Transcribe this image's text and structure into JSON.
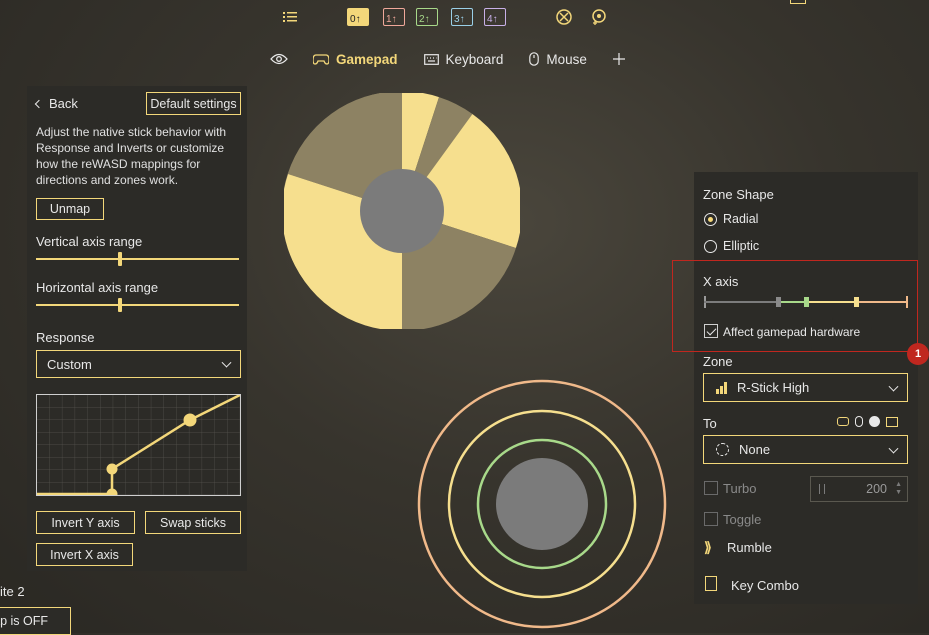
{
  "toolbar": {
    "layers": [
      "0",
      "1",
      "2",
      "3",
      "4"
    ]
  },
  "tabs": [
    {
      "label": "Gamepad",
      "icon": "gamepad-icon"
    },
    {
      "label": "Keyboard",
      "icon": "keyboard-icon"
    },
    {
      "label": "Mouse",
      "icon": "mouse-icon"
    }
  ],
  "left_panel": {
    "back_label": "Back",
    "default_label": "Default settings",
    "description": "Adjust the native stick behavior with Response and Inverts or customize how the reWASD mappings for directions and zones work.",
    "unmap_label": "Unmap",
    "vertical_label": "Vertical axis range",
    "horizontal_label": "Horizontal axis range",
    "response_label": "Response",
    "response_value": "Custom",
    "invert_y_label": "Invert Y axis",
    "swap_label": "Swap sticks",
    "invert_x_label": "Invert X axis"
  },
  "bottom_left": {
    "partial_label": "ite 2",
    "partial_button": "ap is OFF"
  },
  "right_panel": {
    "zone_shape_label": "Zone Shape",
    "radial_label": "Radial",
    "elliptic_label": "Elliptic",
    "x_axis_label": "X axis",
    "affect_label": "Affect gamepad hardware",
    "badge": "1",
    "zone_label": "Zone",
    "zone_value": "R-Stick High",
    "to_label": "To",
    "to_value": "None",
    "turbo_label": "Turbo",
    "turbo_value": "200",
    "toggle_label": "Toggle",
    "rumble_label": "Rumble",
    "keycombo_label": "Key Combo"
  },
  "colors": {
    "accent": "#f3d77a",
    "highlight_red": "#c0271f",
    "zone_green": "#a8d98a",
    "zone_orange": "#f0b98a"
  }
}
